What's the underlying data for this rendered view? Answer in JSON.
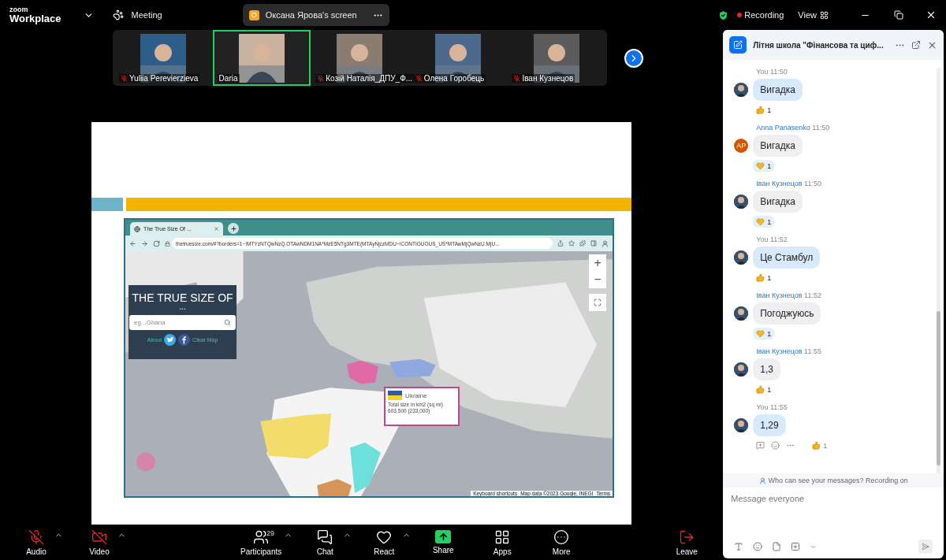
{
  "window": {
    "logo_top": "zoom",
    "logo_bottom": "Workplace",
    "meeting": "Meeting",
    "share_badge": "O",
    "share_label": "Оксана Ярова's screen",
    "recording": "Recording",
    "view": "View"
  },
  "participants": [
    {
      "name": "Yuliia Perevierzieva",
      "muted": true,
      "selected": false
    },
    {
      "name": "Daria",
      "muted": false,
      "selected": true
    },
    {
      "name": "Козій Наталія_ДПУ_Ф...",
      "muted": true,
      "selected": false
    },
    {
      "name": "Олена Горобець",
      "muted": true,
      "selected": false
    },
    {
      "name": "Іван Кузнецов",
      "muted": true,
      "selected": false
    }
  ],
  "browser": {
    "tab_title": "The True Size Of ...",
    "url": "thetruesize.com/#?borders=1~!MTYzNTQwNzQ.OTAwNDM1NA*MzE5NTg3MTE(MTAyNjczMDU~!CONTIGUOUS_US*MTAwMjQwNzU.MjU...",
    "panel_title": "THE TRUE SIZE OF",
    "panel_subtitle": "...",
    "search_placeholder": "eg...Ghana",
    "link_about": "About",
    "link_clear": "Clear Map",
    "zoom_in": "+",
    "zoom_out": "−",
    "tooltip_country": "Ukraine",
    "tooltip_detail": "Total size in km2 (sq mi) 603,500 (233,000)",
    "attribution": [
      "Keyboard shortcuts",
      "Map data ©2023 Google, INEGI",
      "Terms"
    ]
  },
  "chat": {
    "title": "Літня школа \"Фінансова та циф...",
    "messages": [
      {
        "sender": "You",
        "time": "11:50",
        "text": "Вигадка",
        "mine": true,
        "reaction": {
          "kind": "thumbs",
          "count": "1"
        }
      },
      {
        "sender": "Anna Panasenko",
        "time": "11:50",
        "text": "Вигадка",
        "mine": false,
        "avatar": {
          "kind": "initials",
          "initials": "AP",
          "color": "#d35400"
        },
        "reaction": {
          "kind": "heart",
          "count": "1"
        }
      },
      {
        "sender": "Іван Кузнецов",
        "time": "11:50",
        "text": "Вигадка",
        "mine": false,
        "reaction": {
          "kind": "heart",
          "count": "1"
        }
      },
      {
        "sender": "You",
        "time": "11:52",
        "text": "Це Стамбул",
        "mine": true,
        "reaction": {
          "kind": "thumbs",
          "count": "1"
        }
      },
      {
        "sender": "Іван Кузнецов",
        "time": "11:52",
        "text": "Погоджуюсь",
        "mine": false,
        "reaction": {
          "kind": "heart",
          "count": "1"
        }
      },
      {
        "sender": "Іван Кузнецов",
        "time": "11:55",
        "text": "1,3",
        "mine": false,
        "reaction": {
          "kind": "thumbs",
          "count": "1"
        }
      },
      {
        "sender": "You",
        "time": "11:55",
        "text": "1,29",
        "mine": true,
        "reaction": {
          "kind": "thumbs_inline",
          "count": "1"
        }
      }
    ],
    "notice": "Who can see your messages? Recording on",
    "placeholder": "Message everyone"
  },
  "toolbar": [
    {
      "kind": "audio",
      "label": "Audio",
      "caret": true
    },
    {
      "kind": "video",
      "label": "Video",
      "caret": true
    },
    {
      "kind": "participants",
      "label": "Participants",
      "count": "29",
      "caret": true
    },
    {
      "kind": "chat",
      "label": "Chat",
      "caret": true
    },
    {
      "kind": "react",
      "label": "React",
      "caret": true
    },
    {
      "kind": "share",
      "label": "Share",
      "caret": false
    },
    {
      "kind": "apps",
      "label": "Apps",
      "caret": false
    },
    {
      "kind": "more",
      "label": "More",
      "caret": false
    },
    {
      "kind": "leave",
      "label": "Leave",
      "caret": false
    }
  ]
}
